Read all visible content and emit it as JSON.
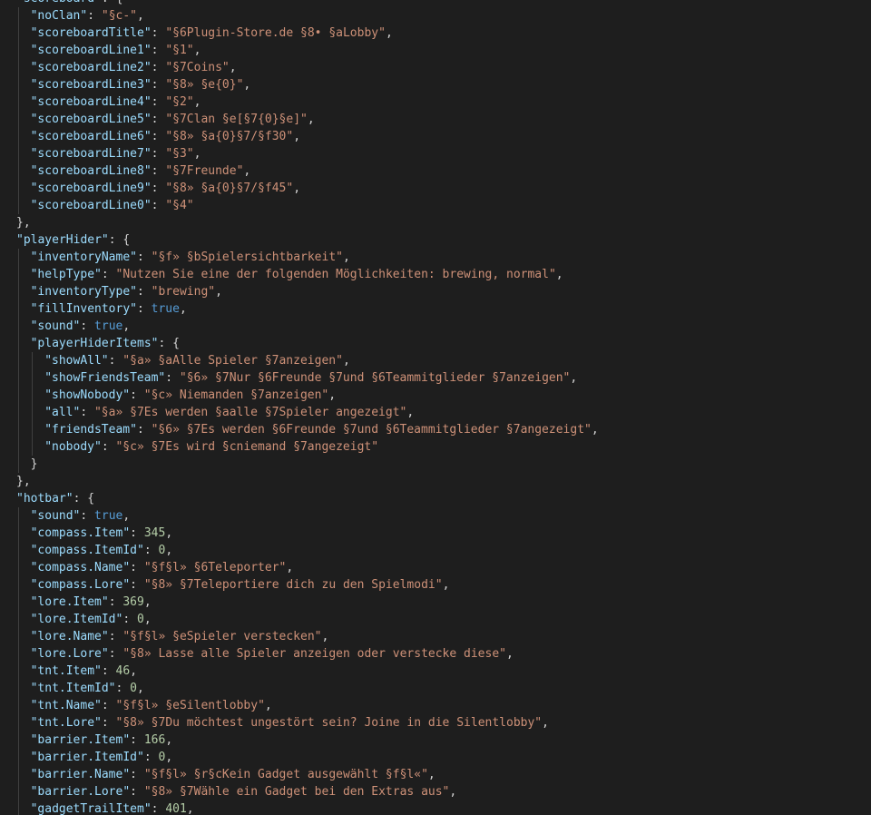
{
  "editor": {
    "lines": [
      {
        "indent": 0,
        "parts": [
          [
            "key",
            "\"scoreboard\""
          ],
          [
            "punc",
            ": {"
          ]
        ]
      },
      {
        "indent": 1,
        "parts": [
          [
            "key",
            "\"noClan\""
          ],
          [
            "punc",
            ": "
          ],
          [
            "str",
            "\"§c-\""
          ],
          [
            "punc",
            ","
          ]
        ]
      },
      {
        "indent": 1,
        "parts": [
          [
            "key",
            "\"scoreboardTitle\""
          ],
          [
            "punc",
            ": "
          ],
          [
            "str",
            "\"§6Plugin-Store.de §8• §aLobby\""
          ],
          [
            "punc",
            ","
          ]
        ]
      },
      {
        "indent": 1,
        "parts": [
          [
            "key",
            "\"scoreboardLine1\""
          ],
          [
            "punc",
            ": "
          ],
          [
            "str",
            "\"§1\""
          ],
          [
            "punc",
            ","
          ]
        ]
      },
      {
        "indent": 1,
        "parts": [
          [
            "key",
            "\"scoreboardLine2\""
          ],
          [
            "punc",
            ": "
          ],
          [
            "str",
            "\"§7Coins\""
          ],
          [
            "punc",
            ","
          ]
        ]
      },
      {
        "indent": 1,
        "parts": [
          [
            "key",
            "\"scoreboardLine3\""
          ],
          [
            "punc",
            ": "
          ],
          [
            "str",
            "\"§8» §e{0}\""
          ],
          [
            "punc",
            ","
          ]
        ]
      },
      {
        "indent": 1,
        "parts": [
          [
            "key",
            "\"scoreboardLine4\""
          ],
          [
            "punc",
            ": "
          ],
          [
            "str",
            "\"§2\""
          ],
          [
            "punc",
            ","
          ]
        ]
      },
      {
        "indent": 1,
        "parts": [
          [
            "key",
            "\"scoreboardLine5\""
          ],
          [
            "punc",
            ": "
          ],
          [
            "str",
            "\"§7Clan §e[§7{0}§e]\""
          ],
          [
            "punc",
            ","
          ]
        ]
      },
      {
        "indent": 1,
        "parts": [
          [
            "key",
            "\"scoreboardLine6\""
          ],
          [
            "punc",
            ": "
          ],
          [
            "str",
            "\"§8» §a{0}§7/§f30\""
          ],
          [
            "punc",
            ","
          ]
        ]
      },
      {
        "indent": 1,
        "parts": [
          [
            "key",
            "\"scoreboardLine7\""
          ],
          [
            "punc",
            ": "
          ],
          [
            "str",
            "\"§3\""
          ],
          [
            "punc",
            ","
          ]
        ]
      },
      {
        "indent": 1,
        "parts": [
          [
            "key",
            "\"scoreboardLine8\""
          ],
          [
            "punc",
            ": "
          ],
          [
            "str",
            "\"§7Freunde\""
          ],
          [
            "punc",
            ","
          ]
        ]
      },
      {
        "indent": 1,
        "parts": [
          [
            "key",
            "\"scoreboardLine9\""
          ],
          [
            "punc",
            ": "
          ],
          [
            "str",
            "\"§8» §a{0}§7/§f45\""
          ],
          [
            "punc",
            ","
          ]
        ]
      },
      {
        "indent": 1,
        "parts": [
          [
            "key",
            "\"scoreboardLine0\""
          ],
          [
            "punc",
            ": "
          ],
          [
            "str",
            "\"§4\""
          ]
        ]
      },
      {
        "indent": 0,
        "parts": [
          [
            "punc",
            "},"
          ]
        ]
      },
      {
        "indent": 0,
        "parts": [
          [
            "key",
            "\"playerHider\""
          ],
          [
            "punc",
            ": {"
          ]
        ]
      },
      {
        "indent": 1,
        "parts": [
          [
            "key",
            "\"inventoryName\""
          ],
          [
            "punc",
            ": "
          ],
          [
            "str",
            "\"§f» §bSpielersichtbarkeit\""
          ],
          [
            "punc",
            ","
          ]
        ]
      },
      {
        "indent": 1,
        "parts": [
          [
            "key",
            "\"helpType\""
          ],
          [
            "punc",
            ": "
          ],
          [
            "str",
            "\"Nutzen Sie eine der folgenden Möglichkeiten: brewing, normal\""
          ],
          [
            "punc",
            ","
          ]
        ]
      },
      {
        "indent": 1,
        "parts": [
          [
            "key",
            "\"inventoryType\""
          ],
          [
            "punc",
            ": "
          ],
          [
            "str",
            "\"brewing\""
          ],
          [
            "punc",
            ","
          ]
        ]
      },
      {
        "indent": 1,
        "parts": [
          [
            "key",
            "\"fillInventory\""
          ],
          [
            "punc",
            ": "
          ],
          [
            "kw",
            "true"
          ],
          [
            "punc",
            ","
          ]
        ]
      },
      {
        "indent": 1,
        "parts": [
          [
            "key",
            "\"sound\""
          ],
          [
            "punc",
            ": "
          ],
          [
            "kw",
            "true"
          ],
          [
            "punc",
            ","
          ]
        ]
      },
      {
        "indent": 1,
        "parts": [
          [
            "key",
            "\"playerHiderItems\""
          ],
          [
            "punc",
            ": {"
          ]
        ]
      },
      {
        "indent": 2,
        "parts": [
          [
            "key",
            "\"showAll\""
          ],
          [
            "punc",
            ": "
          ],
          [
            "str",
            "\"§a» §aAlle Spieler §7anzeigen\""
          ],
          [
            "punc",
            ","
          ]
        ]
      },
      {
        "indent": 2,
        "parts": [
          [
            "key",
            "\"showFriendsTeam\""
          ],
          [
            "punc",
            ": "
          ],
          [
            "str",
            "\"§6» §7Nur §6Freunde §7und §6Teammitglieder §7anzeigen\""
          ],
          [
            "punc",
            ","
          ]
        ]
      },
      {
        "indent": 2,
        "parts": [
          [
            "key",
            "\"showNobody\""
          ],
          [
            "punc",
            ": "
          ],
          [
            "str",
            "\"§c» Niemanden §7anzeigen\""
          ],
          [
            "punc",
            ","
          ]
        ]
      },
      {
        "indent": 2,
        "parts": [
          [
            "key",
            "\"all\""
          ],
          [
            "punc",
            ": "
          ],
          [
            "str",
            "\"§a» §7Es werden §aalle §7Spieler angezeigt\""
          ],
          [
            "punc",
            ","
          ]
        ]
      },
      {
        "indent": 2,
        "parts": [
          [
            "key",
            "\"friendsTeam\""
          ],
          [
            "punc",
            ": "
          ],
          [
            "str",
            "\"§6» §7Es werden §6Freunde §7und §6Teammitglieder §7angezeigt\""
          ],
          [
            "punc",
            ","
          ]
        ]
      },
      {
        "indent": 2,
        "parts": [
          [
            "key",
            "\"nobody\""
          ],
          [
            "punc",
            ": "
          ],
          [
            "str",
            "\"§c» §7Es wird §cniemand §7angezeigt\""
          ]
        ]
      },
      {
        "indent": 1,
        "parts": [
          [
            "punc",
            "}"
          ]
        ]
      },
      {
        "indent": 0,
        "parts": [
          [
            "punc",
            "},"
          ]
        ]
      },
      {
        "indent": 0,
        "parts": [
          [
            "key",
            "\"hotbar\""
          ],
          [
            "punc",
            ": {"
          ]
        ]
      },
      {
        "indent": 1,
        "parts": [
          [
            "key",
            "\"sound\""
          ],
          [
            "punc",
            ": "
          ],
          [
            "kw",
            "true"
          ],
          [
            "punc",
            ","
          ]
        ]
      },
      {
        "indent": 1,
        "parts": [
          [
            "key",
            "\"compass.Item\""
          ],
          [
            "punc",
            ": "
          ],
          [
            "num",
            "345"
          ],
          [
            "punc",
            ","
          ]
        ]
      },
      {
        "indent": 1,
        "parts": [
          [
            "key",
            "\"compass.ItemId\""
          ],
          [
            "punc",
            ": "
          ],
          [
            "num",
            "0"
          ],
          [
            "punc",
            ","
          ]
        ]
      },
      {
        "indent": 1,
        "parts": [
          [
            "key",
            "\"compass.Name\""
          ],
          [
            "punc",
            ": "
          ],
          [
            "str",
            "\"§f§l» §6Teleporter\""
          ],
          [
            "punc",
            ","
          ]
        ]
      },
      {
        "indent": 1,
        "parts": [
          [
            "key",
            "\"compass.Lore\""
          ],
          [
            "punc",
            ": "
          ],
          [
            "str",
            "\"§8» §7Teleportiere dich zu den Spielmodi\""
          ],
          [
            "punc",
            ","
          ]
        ]
      },
      {
        "indent": 1,
        "parts": [
          [
            "key",
            "\"lore.Item\""
          ],
          [
            "punc",
            ": "
          ],
          [
            "num",
            "369"
          ],
          [
            "punc",
            ","
          ]
        ]
      },
      {
        "indent": 1,
        "parts": [
          [
            "key",
            "\"lore.ItemId\""
          ],
          [
            "punc",
            ": "
          ],
          [
            "num",
            "0"
          ],
          [
            "punc",
            ","
          ]
        ]
      },
      {
        "indent": 1,
        "parts": [
          [
            "key",
            "\"lore.Name\""
          ],
          [
            "punc",
            ": "
          ],
          [
            "str",
            "\"§f§l» §eSpieler verstecken\""
          ],
          [
            "punc",
            ","
          ]
        ]
      },
      {
        "indent": 1,
        "parts": [
          [
            "key",
            "\"lore.Lore\""
          ],
          [
            "punc",
            ": "
          ],
          [
            "str",
            "\"§8» Lasse alle Spieler anzeigen oder verstecke diese\""
          ],
          [
            "punc",
            ","
          ]
        ]
      },
      {
        "indent": 1,
        "parts": [
          [
            "key",
            "\"tnt.Item\""
          ],
          [
            "punc",
            ": "
          ],
          [
            "num",
            "46"
          ],
          [
            "punc",
            ","
          ]
        ]
      },
      {
        "indent": 1,
        "parts": [
          [
            "key",
            "\"tnt.ItemId\""
          ],
          [
            "punc",
            ": "
          ],
          [
            "num",
            "0"
          ],
          [
            "punc",
            ","
          ]
        ]
      },
      {
        "indent": 1,
        "parts": [
          [
            "key",
            "\"tnt.Name\""
          ],
          [
            "punc",
            ": "
          ],
          [
            "str",
            "\"§f§l» §eSilentlobby\""
          ],
          [
            "punc",
            ","
          ]
        ]
      },
      {
        "indent": 1,
        "parts": [
          [
            "key",
            "\"tnt.Lore\""
          ],
          [
            "punc",
            ": "
          ],
          [
            "str",
            "\"§8» §7Du möchtest ungestört sein? Joine in die Silentlobby\""
          ],
          [
            "punc",
            ","
          ]
        ]
      },
      {
        "indent": 1,
        "parts": [
          [
            "key",
            "\"barrier.Item\""
          ],
          [
            "punc",
            ": "
          ],
          [
            "num",
            "166"
          ],
          [
            "punc",
            ","
          ]
        ]
      },
      {
        "indent": 1,
        "parts": [
          [
            "key",
            "\"barrier.ItemId\""
          ],
          [
            "punc",
            ": "
          ],
          [
            "num",
            "0"
          ],
          [
            "punc",
            ","
          ]
        ]
      },
      {
        "indent": 1,
        "parts": [
          [
            "key",
            "\"barrier.Name\""
          ],
          [
            "punc",
            ": "
          ],
          [
            "str",
            "\"§f§l» §r§cKein Gadget ausgewählt §f§l«\""
          ],
          [
            "punc",
            ","
          ]
        ]
      },
      {
        "indent": 1,
        "parts": [
          [
            "key",
            "\"barrier.Lore\""
          ],
          [
            "punc",
            ": "
          ],
          [
            "str",
            "\"§8» §7Wähle ein Gadget bei den Extras aus\""
          ],
          [
            "punc",
            ","
          ]
        ]
      },
      {
        "indent": 1,
        "parts": [
          [
            "key",
            "\"gadgetTrailItem\""
          ],
          [
            "punc",
            ": "
          ],
          [
            "num",
            "401"
          ],
          [
            "punc",
            ","
          ]
        ]
      }
    ]
  }
}
